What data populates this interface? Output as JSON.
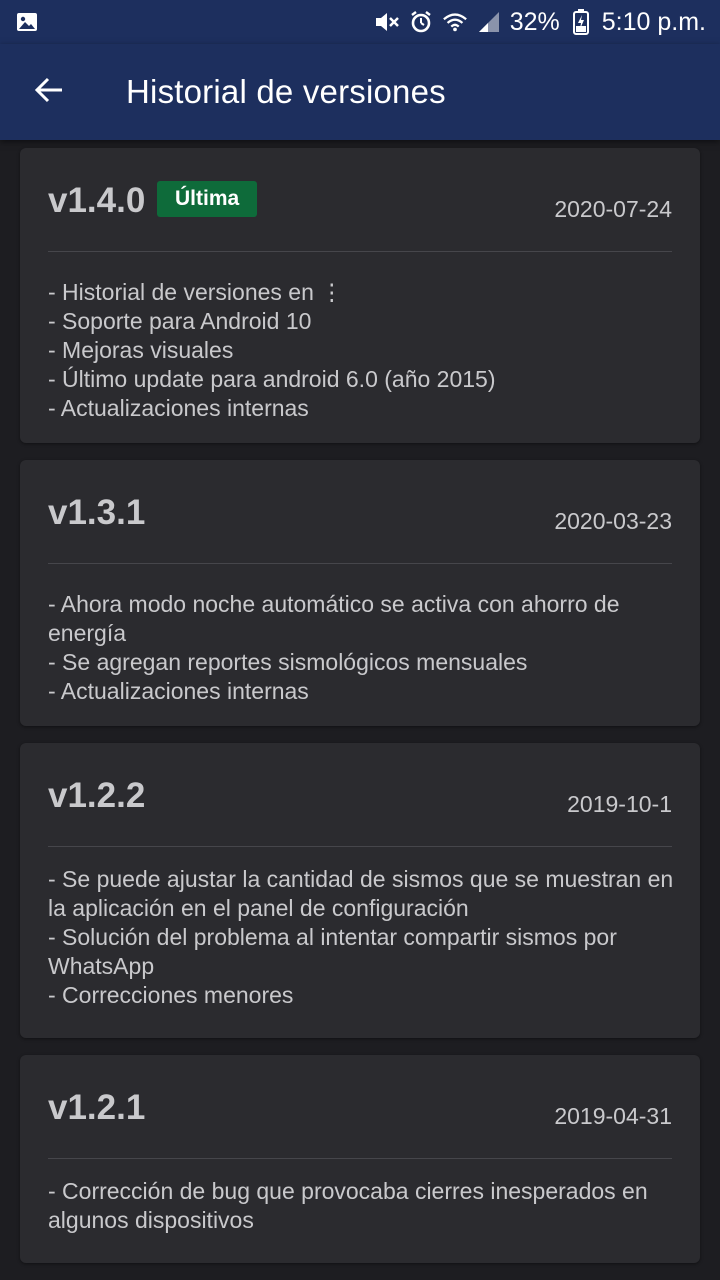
{
  "status_bar": {
    "battery": "32%",
    "time": "5:10 p.m.",
    "icons": [
      "image-icon",
      "mute-icon",
      "alarm-icon",
      "wifi-icon",
      "signal-icon",
      "battery-icon"
    ]
  },
  "app_bar": {
    "back_icon": "arrow-back-icon",
    "title": "Historial de versiones",
    "background": "#1d2f5e"
  },
  "versions": [
    {
      "version": "v1.4.0",
      "badge": "Última",
      "date": "2020-07-24",
      "notes": [
        "- Historial de versiones en ⋮",
        "- Soporte para Android 10",
        "- Mejoras visuales",
        "- Último update para android 6.0 (año 2015)",
        "- Actualizaciones internas"
      ]
    },
    {
      "version": "v1.3.1",
      "date": "2020-03-23",
      "notes": [
        "- Ahora modo noche automático se activa con ahorro de energía",
        "- Se agregan reportes sismológicos mensuales",
        "- Actualizaciones internas"
      ]
    },
    {
      "version": "v1.2.2",
      "date": "2019-10-1",
      "notes": [
        "- Se puede ajustar la cantidad de sismos que se muestran en la aplicación en el panel de configuración",
        "- Solución del problema al intentar compartir sismos por WhatsApp",
        "- Correcciones menores"
      ]
    },
    {
      "version": "v1.2.1",
      "date": "2019-04-31",
      "notes": [
        "- Corrección de bug que provocaba cierres inesperados en algunos dispositivos"
      ]
    }
  ],
  "colors": {
    "background": "#1d1d21",
    "card": "#2b2b2f",
    "badge": "#0e6b3a",
    "text": "#c9c9cc"
  }
}
